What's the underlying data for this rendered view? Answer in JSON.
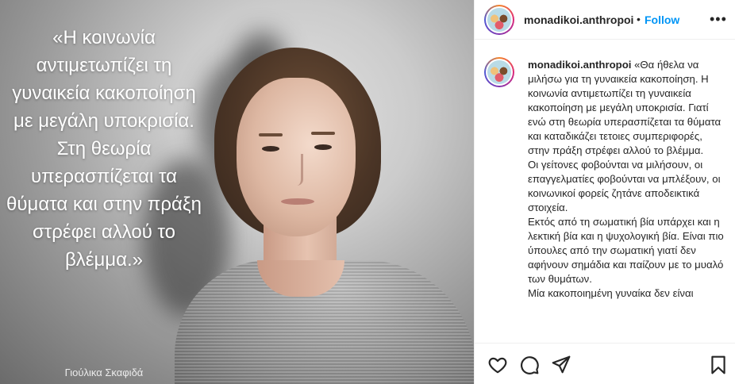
{
  "post_image": {
    "quote": "«Η κοινωνία αντιμετωπίζει τη γυναικεία κακοποίηση με μεγάλη υποκρισία.\nΣτη θεωρία υπερασπίζεται τα θύματα και στην πράξη στρέφει αλλού το βλέμμα.»",
    "author": "Γιούλικα Σκαφιδά"
  },
  "header": {
    "username": "monadikoi.anthropoi",
    "separator": "•",
    "follow_label": "Follow",
    "more_icon": "more-horizontal-icon"
  },
  "caption": {
    "username": "monadikoi.anthropoi",
    "text": "«Θα ήθελα να μιλήσω για τη γυναικεία κακοποίηση. Η κοινωνία αντιμετωπίζει τη γυναικεία κακοποίηση με μεγάλη υποκρισία. Γιατί ενώ στη θεωρία υπερασπίζεται τα θύματα και καταδικάζει τετοιες συμπεριφορές, στην πράξη στρέφει αλλού το βλέμμα.\nΟι γείτονες φοβούνται να μιλήσουν, οι επαγγελματίες φοβούνται να μπλέξουν, οι κοινωνικοί φορείς ζητάνε αποδεικτικά στοιχεία.\nΕκτός από τη σωματική βία υπάρχει και η λεκτική βία και η ψυχολογική βία. Είναι πιο ύπουλες από την σωματική γιατί δεν αφήνουν σημάδια και παίζουν με το μυαλό των θυμάτων.\nΜία κακοποιημένη γυναίκα δεν είναι"
  },
  "actions": {
    "like_icon": "heart-icon",
    "comment_icon": "comment-icon",
    "share_icon": "share-icon",
    "save_icon": "bookmark-icon"
  }
}
